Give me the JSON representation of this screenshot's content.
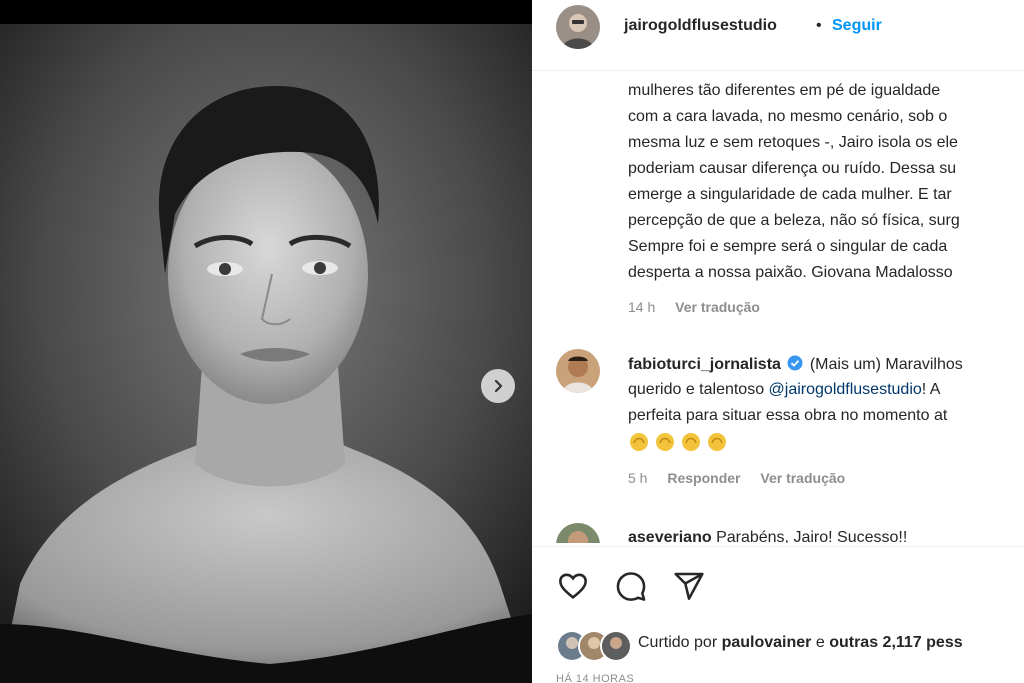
{
  "post": {
    "username": "jairogoldflusestudio",
    "separator": "•",
    "follow_label": "Seguir"
  },
  "caption": {
    "lines": [
      "mulheres tão diferentes em pé de igualdade",
      "com a cara lavada, no mesmo cenário, sob o",
      "mesma luz e sem retoques -, Jairo isola os ele",
      "poderiam causar diferença ou ruído. Dessa su",
      "emerge a singularidade de cada mulher. E tar",
      "percepção de que a beleza, não só física, surg",
      "Sempre foi e sempre será o singular de cada",
      "desperta a nossa paixão. Giovana Madalosso"
    ],
    "time": "14 h",
    "translate_label": "Ver tradução"
  },
  "comments": [
    {
      "username": "fabioturci_jornalista",
      "verified_icon": "verified-badge-icon",
      "line1": "(Mais um) Maravilhos",
      "line2_prefix": "querido e talentoso ",
      "line2_mention": "@jairogoldflusestudio",
      "line2_suffix": "! A",
      "line3": "perfeita para situar essa obra no momento at",
      "emoji": [
        "👏",
        "👏",
        "👏",
        "👏"
      ],
      "time": "5 h",
      "reply_label": "Responder",
      "translate_label": "Ver tradução"
    },
    {
      "username": "aseveriano",
      "text": "Parabéns, Jairo! Sucesso!!"
    }
  ],
  "actions": [
    "heart-icon",
    "comment-icon",
    "share-icon"
  ],
  "likes": {
    "prefix": "Curtido por ",
    "user": "paulovainer",
    "middle": " e ",
    "others": "outras 2,117 pess"
  },
  "time_ago": "HÁ 14 HORAS",
  "colors": {
    "accent": "#0095f6",
    "mention": "#00376b",
    "muted": "#8e8e8e",
    "verified": "#3897f0"
  }
}
